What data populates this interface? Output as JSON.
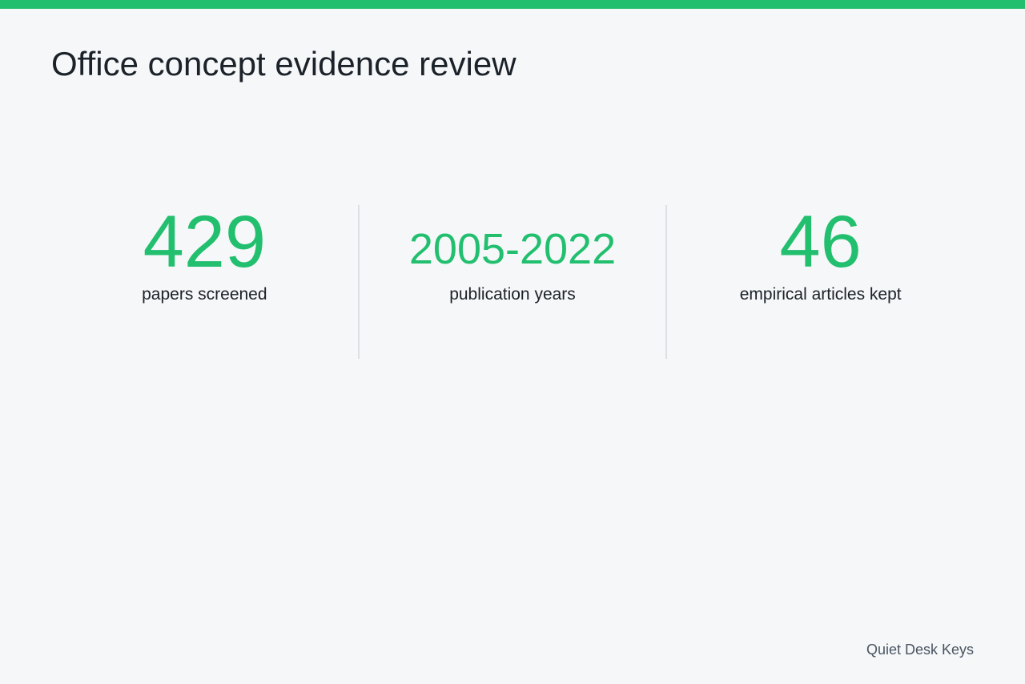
{
  "header": {
    "title": "Office concept evidence review",
    "accent_color": "#22bf6f"
  },
  "stats": [
    {
      "value": "429",
      "label": "papers screened"
    },
    {
      "value": "2005-2022",
      "label": "publication years"
    },
    {
      "value": "46",
      "label": "empirical articles kept"
    }
  ],
  "footer": {
    "brand": "Quiet Desk Keys"
  }
}
